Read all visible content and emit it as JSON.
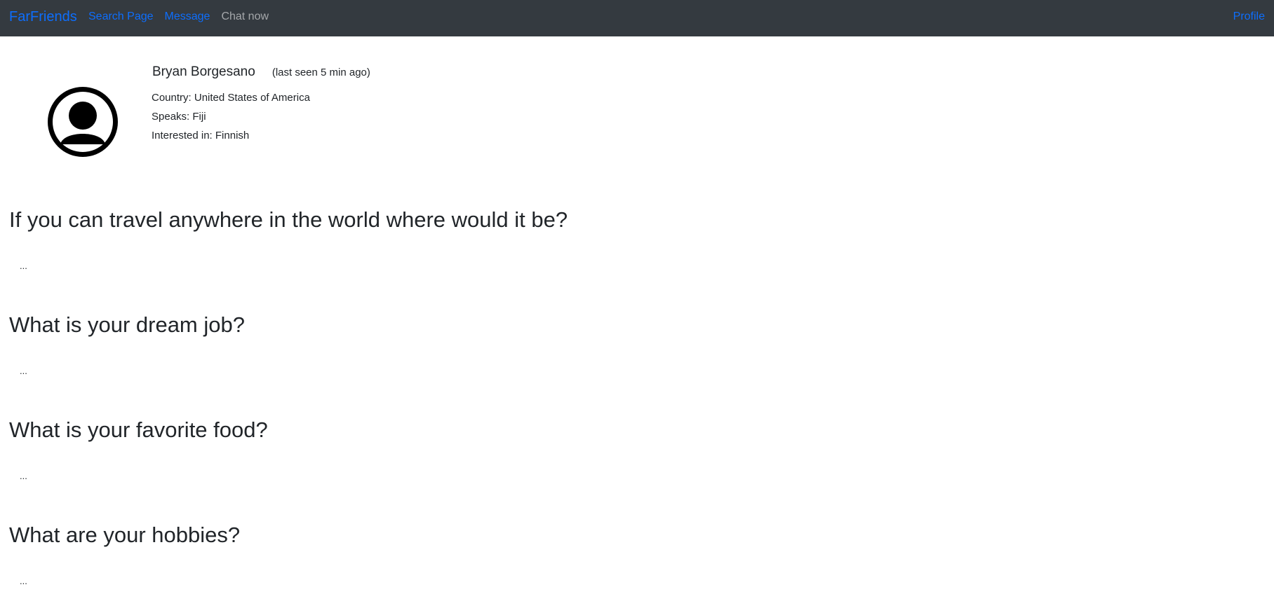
{
  "navbar": {
    "brand": "FarFriends",
    "links": [
      {
        "label": "Search Page"
      },
      {
        "label": "Message"
      },
      {
        "label": "Chat now"
      }
    ],
    "profile_label": "Profile",
    "background_color": "#343a40",
    "link_color": "#0d6efd"
  },
  "profile": {
    "avatar_icon": "user-circle-icon",
    "name": "Bryan Borgesano",
    "last_seen": "(last seen 5 min ago)",
    "country": "Country: United States of America",
    "speaks": "Speaks: Fiji",
    "interested_in": "Interested in: Finnish"
  },
  "questions": [
    {
      "question": "If you can travel anywhere in the world where would it be?",
      "answer": "..."
    },
    {
      "question": "What is your dream job?",
      "answer": "..."
    },
    {
      "question": "What is your favorite food?",
      "answer": "..."
    },
    {
      "question": "What are your hobbies?",
      "answer": "..."
    }
  ]
}
